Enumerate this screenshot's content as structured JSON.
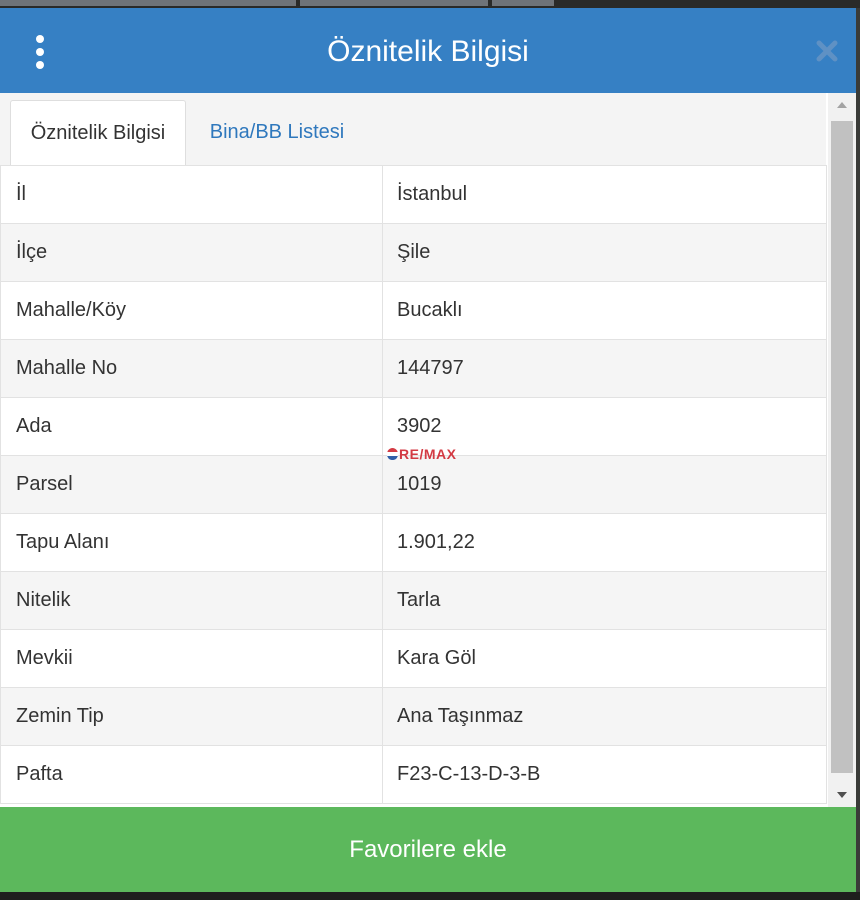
{
  "dialog": {
    "title": "Öznitelik Bilgisi",
    "icons": {
      "menu": "vertical-ellipsis-icon",
      "close": "close-icon"
    }
  },
  "tabs": [
    {
      "label": "Öznitelik Bilgisi",
      "active": true
    },
    {
      "label": "Bina/BB Listesi",
      "active": false
    }
  ],
  "attributes": [
    {
      "label": "İl",
      "value": "İstanbul"
    },
    {
      "label": "İlçe",
      "value": "Şile"
    },
    {
      "label": "Mahalle/Köy",
      "value": "Bucaklı"
    },
    {
      "label": "Mahalle No",
      "value": "144797"
    },
    {
      "label": "Ada",
      "value": "3902"
    },
    {
      "label": "Parsel",
      "value": "1019"
    },
    {
      "label": "Tapu Alanı",
      "value": "1.901,22"
    },
    {
      "label": "Nitelik",
      "value": "Tarla"
    },
    {
      "label": "Mevkii",
      "value": "Kara Göl"
    },
    {
      "label": "Zemin Tip",
      "value": "Ana Taşınmaz"
    },
    {
      "label": "Pafta",
      "value": "F23-C-13-D-3-B"
    }
  ],
  "watermark": {
    "text": "RE/MAX"
  },
  "footer": {
    "button_label": "Favorilere ekle"
  },
  "colors": {
    "header": "#3680c4",
    "tab_link": "#2f78bd",
    "footer_button": "#5cb85c",
    "watermark": "#d33a43"
  }
}
